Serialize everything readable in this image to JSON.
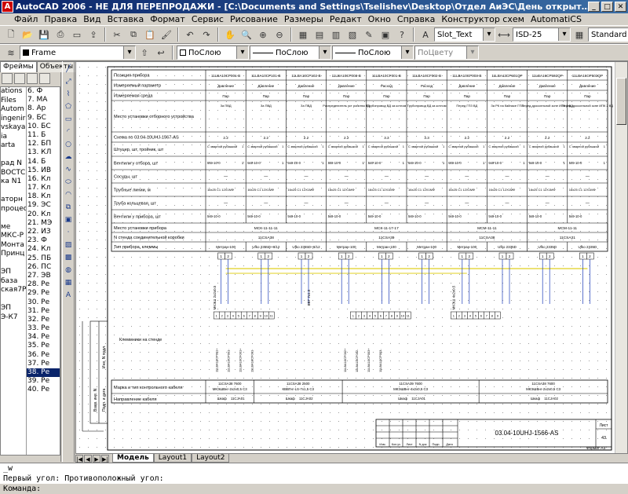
{
  "window": {
    "app_icon": "autocad-logo-icon",
    "title": "AutoCAD 2006 - НЕ ДЛЯ ПЕРЕПРОДАЖИ - [C:\\Documents and Settings\\Tselishev\\Desktop\\Отдел АиЭС\\День открытых дверей\\..."
  },
  "menu": [
    "Файл",
    "Правка",
    "Вид",
    "Вставка",
    "Формат",
    "Сервис",
    "Рисование",
    "Размеры",
    "Редакт",
    "Окно",
    "Справка",
    "Конструктор схем",
    "AutomatiCS"
  ],
  "toolbar1": {
    "text_style": "Slot_Text",
    "dim_style": "ISD-25",
    "table_style": "Standard"
  },
  "toolbar2": {
    "layer": "Frame",
    "color": "ПоСлою",
    "linetype": "ПоСлою",
    "lineweight": "ПоСлою",
    "plotstyle": "ПоЦвету"
  },
  "left_panel": {
    "tabs": [
      "Фреймы",
      "Объекты"
    ],
    "left_items": [
      "ations",
      "Files",
      "Autom",
      "ingenir",
      "vskaya",
      "ia",
      "arta",
      "",
      "рад N",
      "ВОСТС",
      "ка N1",
      "",
      "аторн",
      "процес",
      "",
      "ме",
      "МКС-Р",
      "Монта",
      "Принц",
      "",
      "ЭП",
      "база",
      "ская7Р",
      "",
      "ЭП",
      "Э-К7"
    ],
    "right_items": [
      "6. Ф",
      "7. МА",
      "8. Ар",
      "9. БС",
      "10. БС",
      "11. Б",
      "12. БП",
      "13. КЛ",
      "14. Б",
      "15. ИВ",
      "16. Кл",
      "17. Кл",
      "18. Кл",
      "19. ЭС",
      "20. Кл",
      "21. МЭ",
      "22. ИЗ",
      "23. Ф",
      "24. Кл",
      "25. ПБ",
      "26. ПС",
      "27. ЭВ",
      "28. Ре",
      "29. Ре",
      "30. Ре",
      "31. Ре",
      "32. Ре",
      "33. Ре",
      "34. Ре",
      "35. Ре",
      "36. Ре",
      "37. Ре",
      "38. Ре",
      "39. Ре",
      "40. Ре"
    ],
    "selected_index": 32
  },
  "drawing": {
    "row_labels": [
      "Позиция прибора",
      "Измеряемый параметр",
      "Измеряемая среда",
      "Место установки отборного устройства",
      "Схема по 03.04-10UHJ-1567-AS",
      "Штуцер, шт, тройник, шт",
      "Вентили у отбора, шт",
      "Сосуды, шт",
      "Трубные линии, м",
      "Труба кольцевая, шт",
      "Вентили у прибора, шт",
      "Место установки прибора",
      "N стенда соединительной коробки",
      "Тип прибора, клеммы"
    ],
    "columns": [
      {
        "pos": "11LBA10CP001-B",
        "param": "Давление",
        "medium": "Пар",
        "place": "За ПВД",
        "scheme": "2.2"
      },
      {
        "pos": "11LBA10CP101-B",
        "param": "Давление",
        "medium": "Пар",
        "place": "За ПВД",
        "scheme": "2.2"
      },
      {
        "pos": "11LBA10CP102-B",
        "param": "Давление",
        "medium": "Пар",
        "place": "За ПВД",
        "scheme": "2.2"
      },
      {
        "pos": "11LBA10CP003-B",
        "param": "Давление",
        "medium": "Пар",
        "place": "Распределитель уст ройства ВД",
        "scheme": "2.2"
      },
      {
        "pos": "11LBA10CF001-B",
        "param": "Расход",
        "medium": "Пар",
        "place": "Трубопровод ВД за котлом",
        "scheme": "3.3"
      },
      {
        "pos": "11LBA10CF002-B",
        "param": "Расход",
        "medium": "Пар",
        "place": "Трубопровод ВД за котлом",
        "scheme": "3.3"
      },
      {
        "pos": "11LBA10CP003-B",
        "param": "Давление",
        "medium": "Пар",
        "place": "Перед ГПЗ ВД",
        "scheme": "2.2"
      },
      {
        "pos": "11LBA13CP501QP",
        "param": "Давление",
        "medium": "Пар",
        "place": "За РК на байпасе ГПЗ",
        "scheme": "2.2"
      },
      {
        "pos": "11LBA16CP502QP",
        "param": "Давление",
        "medium": "Пар",
        "place": "Перед дроссельной зоне ИПК 1 ВД",
        "scheme": "2.2"
      },
      {
        "pos": "11LBA16CP503QP",
        "param": "Давление",
        "medium": "Пар",
        "place": "Перед дроссельной зоне ИПК 2 ВД",
        "scheme": "2.2"
      }
    ],
    "stand_locations": [
      "МСК-11-11-11",
      "МСК-11-17-17",
      "МСМ-11-11",
      "МСМ-11-11"
    ],
    "junction_boxes": [
      "11CSA38",
      "11CSA39",
      "11CSA38",
      "11CSA31"
    ],
    "device_types": [
      "Метран-100",
      "Ufko 2355D+8/12",
      "Ufko 2355D+8/12",
      "Метран-100",
      "Метран-100",
      "Метран-100",
      "Метран-100",
      "Ufko 2335D",
      "Ufko 2335D",
      "Ufko 2335D"
    ],
    "terminal_label": "Клеммники на стенде",
    "cable_header": "Марка и тип контрольного кабеля",
    "cable_direction": "Направление кабеля",
    "cables": [
      {
        "id": "11CSA38 7600",
        "type": "МКЭШВнг-2х2х0,5 С3",
        "dir": "Шкаф",
        "box": "11CJA01"
      },
      {
        "id": "11CSA38 2500",
        "type": "КВВГнг-LS-7х1,5 С3",
        "dir": "Шкаф",
        "box": "11CJA02"
      },
      {
        "id": "11CSA39 7600",
        "type": "МКЭШВнг-4х2х0,5 С3",
        "dir": "Шкаф",
        "box": "11CJA01"
      },
      {
        "id": "11CSA38 7600",
        "type": "МКЭШВнг-2х2х0,5 С3",
        "dir": "Шкаф",
        "box": "11CJA02"
      }
    ],
    "stamp_code": "03.04-10UHJ-1566-AS",
    "stamp_headers": [
      "Изм.",
      "Кол.уч",
      "Лист",
      "N док",
      "Подп.",
      "Дата"
    ],
    "sheet_label": "Лист",
    "sheet_number": "43",
    "format": "Формат А3",
    "side_labels": [
      "Взам. инв. N",
      "Подп. и дата",
      "Инв. N подл."
    ]
  },
  "layout_tabs": [
    "Модель",
    "Layout1",
    "Layout2"
  ],
  "active_layout": 0,
  "command_line": [
    "_w",
    "Первый угол: Противоположный угол:",
    "Команда:"
  ],
  "colors": {
    "title_start": "#0a246a",
    "title_end": "#3a6ea5",
    "highlight_wire": "#e0d020",
    "wire_blue": "#1a3ab8"
  }
}
